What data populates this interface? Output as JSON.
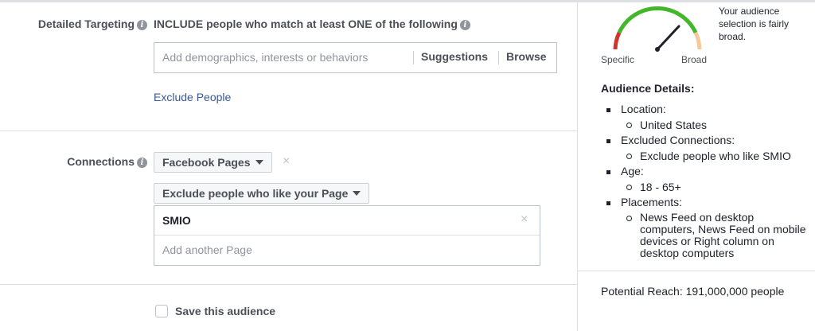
{
  "targeting": {
    "label": "Detailed Targeting",
    "include_text": "INCLUDE people who match at least ONE of the following",
    "search_placeholder": "Add demographics, interests or behaviors",
    "suggestions_label": "Suggestions",
    "browse_label": "Browse",
    "exclude_link": "Exclude People"
  },
  "connections": {
    "label": "Connections",
    "type_dropdown": "Facebook Pages",
    "rule_dropdown": "Exclude people who like your Page",
    "selected_page": "SMIO",
    "add_page_placeholder": "Add another Page"
  },
  "save": {
    "label": "Save this audience"
  },
  "gauge": {
    "message": "Your audience selection is fairly broad.",
    "specific_label": "Specific",
    "broad_label": "Broad"
  },
  "details": {
    "heading": "Audience Details:",
    "items": [
      {
        "label": "Location:",
        "sub": "United States"
      },
      {
        "label": "Excluded Connections:",
        "sub": "Exclude people who like SMIO"
      },
      {
        "label": "Age:",
        "sub": "18 - 65+"
      },
      {
        "label": "Placements:",
        "sub": "News Feed on desktop computers, News Feed on mobile devices or Right column on desktop computers"
      }
    ]
  },
  "reach": {
    "text": "Potential Reach: 191,000,000 people"
  },
  "colors": {
    "gauge_red": "#d0352b",
    "gauge_green": "#42b72a",
    "gauge_orange": "#f7c89b",
    "link": "#365899"
  }
}
